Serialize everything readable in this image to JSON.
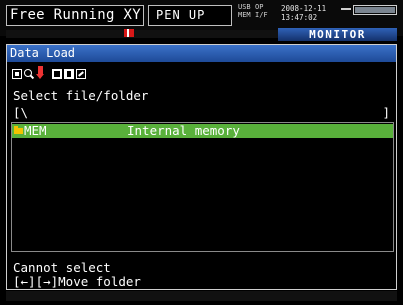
{
  "header": {
    "mode": "Free Running XY",
    "pen": "PEN  UP",
    "io_labels": [
      "USB",
      "OP",
      "MEM",
      "I/F"
    ],
    "date": "2008-12-11",
    "time": "13:47:02",
    "monitor_tab": "MONITOR"
  },
  "dialog": {
    "title": "Data Load",
    "toolbar_icons": [
      "first-icon",
      "search-icon",
      "load-icon",
      "select-icon",
      "file-icon",
      "edit-icon"
    ],
    "prompt": "Select file/folder",
    "path_open": "[\\",
    "path_close": "]",
    "entries": [
      {
        "name": "MEM",
        "description": "Internal memory"
      }
    ],
    "status_line1": "Cannot select",
    "status_line2": "[←][→]Move folder"
  },
  "colors": {
    "title_bar": "#2f62b8",
    "selection": "#59b03b",
    "folder_icon": "#f2c300",
    "alert_icon": "#e33333"
  }
}
